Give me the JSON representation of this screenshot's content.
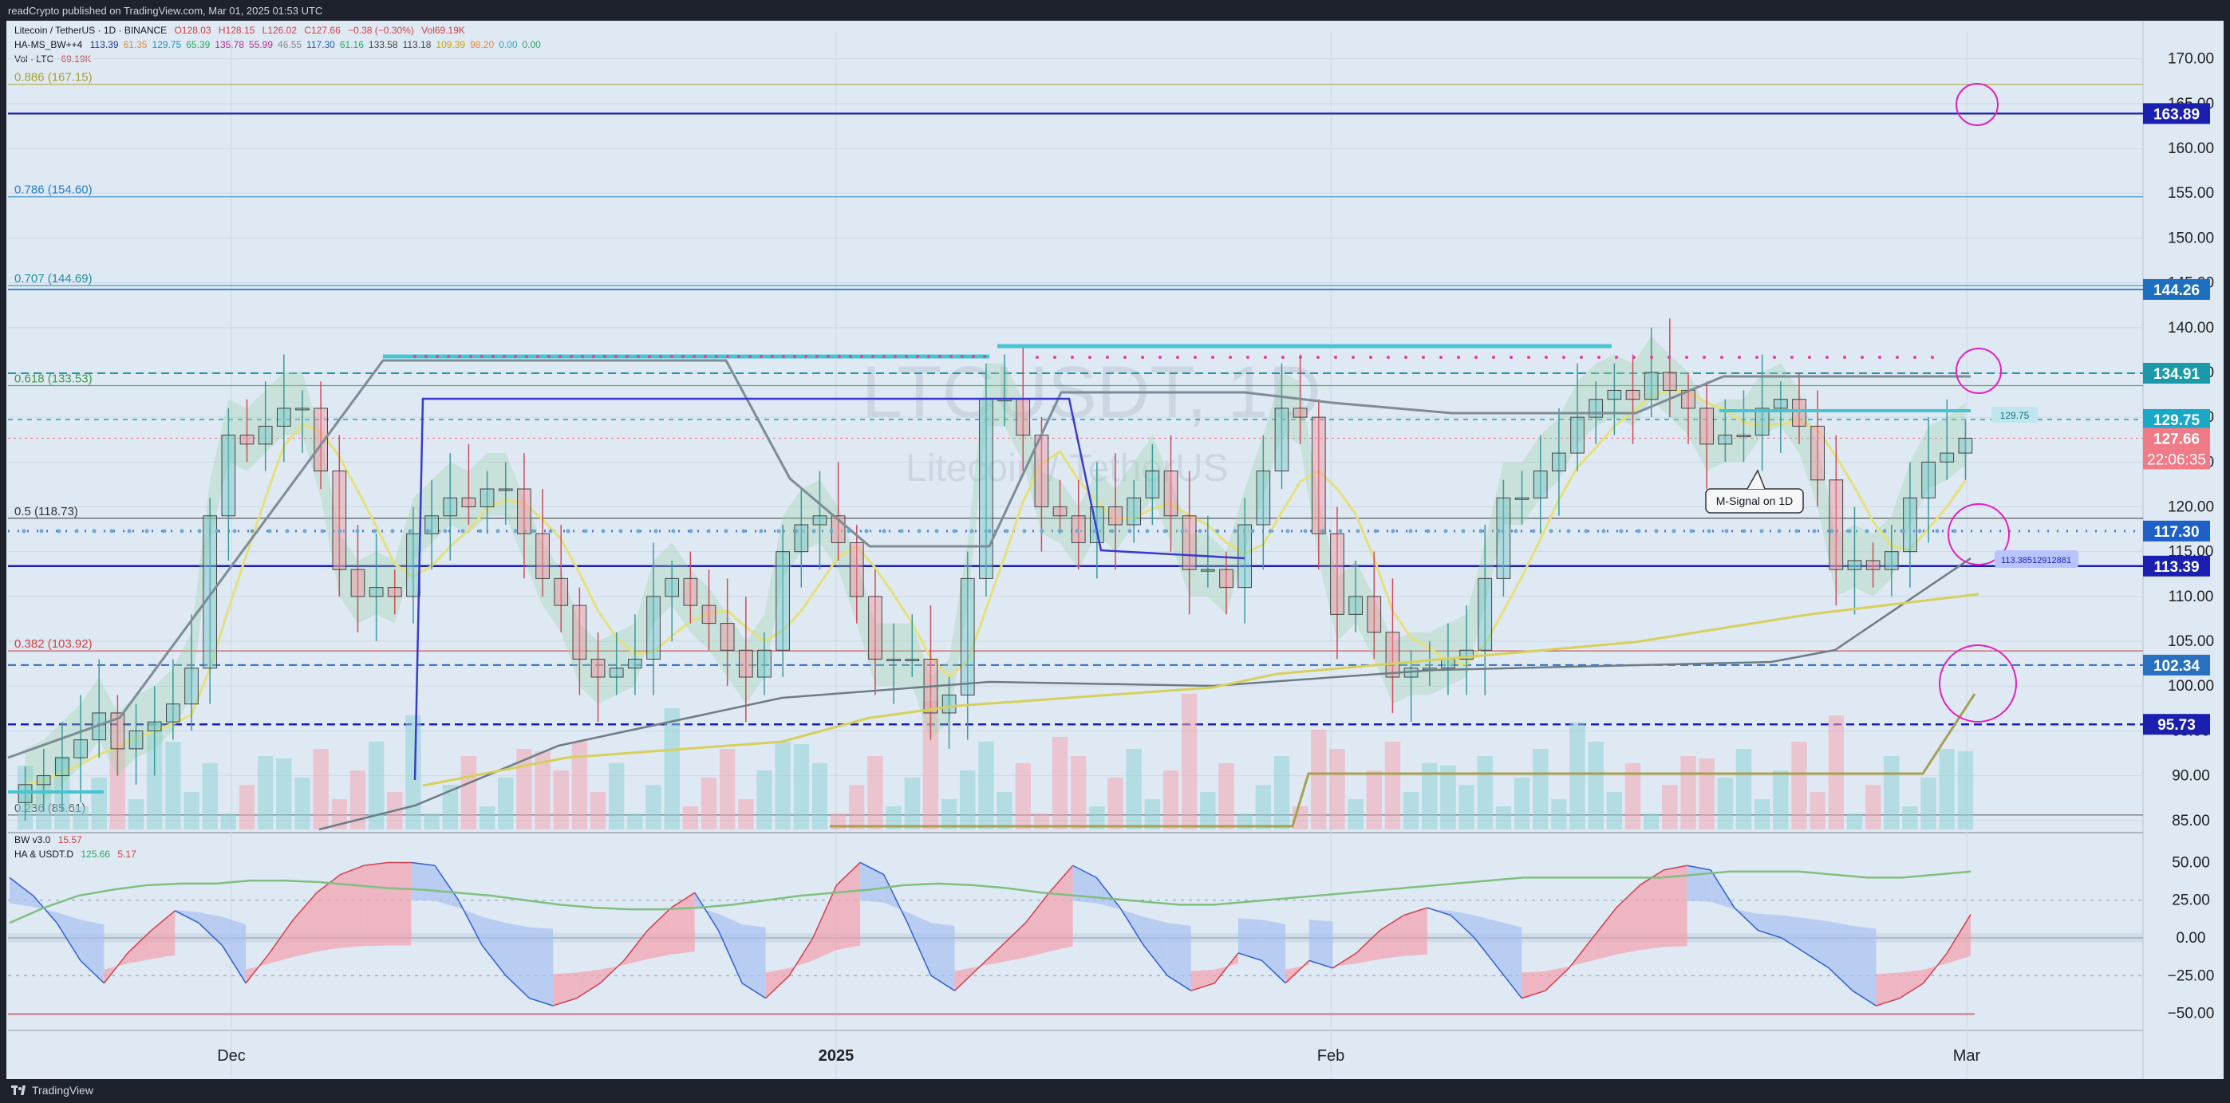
{
  "header": {
    "published_by": "readCrypto published on TradingView.com, Mar 01, 2025 01:53 UTC"
  },
  "footer": {
    "brand": "TradingView"
  },
  "legend": {
    "symbol_line": "Litecoin / TetherUS · 1D · BINANCE",
    "ohlc": {
      "o": "O128.03",
      "h": "H128.15",
      "l": "L126.02",
      "c": "C127.66",
      "chg": "−0.38 (−0.30%)",
      "vol": "Vol69.19K"
    },
    "ind1_name": "HA-MS_BW++4",
    "ind1_values": [
      "113.39",
      "61.35",
      "129.75",
      "65.39",
      "135.78",
      "55.99",
      "46.55",
      "117.30",
      "61.16",
      "133.58",
      "113.18",
      "109.39",
      "98.20",
      "0.00",
      "0.00"
    ],
    "ind1_colors": [
      "#1e3a8a",
      "#e8863a",
      "#1e90c0",
      "#2aa860",
      "#b03090",
      "#b03090",
      "#888888",
      "#1e60c0",
      "#2aa860",
      "#444444",
      "#444444",
      "#c9a400",
      "#e8863a",
      "#2aa8c0",
      "#2aa860"
    ],
    "vol_line": "Vol · LTC",
    "vol_value": "69.19K",
    "osc_name": "BW v3.0",
    "osc_value": "15.57",
    "ha_name": "HA & USDT.D",
    "ha_values": [
      "125.66",
      "5.17"
    ]
  },
  "watermark": {
    "symbol": "LTCUSDT, 1D",
    "name": "Litecoin / TetherUS"
  },
  "annotation": {
    "msignal": "M-Signal on 1D",
    "small_tag": "129.75",
    "band_tag": "113.38512912881"
  },
  "fib_labels": [
    {
      "text": "0.886 (167.15)",
      "price": 167.15,
      "color": "#a8a030"
    },
    {
      "text": "0.786 (154.60)",
      "price": 154.6,
      "color": "#2a7fbf"
    },
    {
      "text": "0.707 (144.69)",
      "price": 144.69,
      "color": "#1f8f9f"
    },
    {
      "text": "0.618 (133.53)",
      "price": 133.53,
      "color": "#3a9a4a"
    },
    {
      "text": "0.5 (118.73)",
      "price": 118.73,
      "color": "#333333"
    },
    {
      "text": "0.382 (103.92)",
      "price": 103.92,
      "color": "#d04040"
    },
    {
      "text": "0.236 (85.61)",
      "price": 85.61,
      "color": "#555555"
    }
  ],
  "price_tags": [
    {
      "text": "163.89",
      "price": 163.89,
      "bg": "#1a1fb0"
    },
    {
      "text": "144.26",
      "price": 144.26,
      "bg": "#1e6fbf"
    },
    {
      "text": "134.91",
      "price": 134.91,
      "bg": "#1a9aa8"
    },
    {
      "text": "129.75",
      "price": 129.75,
      "bg": "#1aa8c8"
    },
    {
      "text": "127.66",
      "price": 127.66,
      "bg": "#f07a86"
    },
    {
      "text": "117.30",
      "price": 117.3,
      "bg": "#1e5fc8"
    },
    {
      "text": "113.39",
      "price": 113.39,
      "bg": "#1a1fb0"
    },
    {
      "text": "102.34",
      "price": 102.34,
      "bg": "#2a70c0"
    },
    {
      "text": "95.73",
      "price": 95.73,
      "bg": "#1a1fb0"
    }
  ],
  "countdown": "22:06:35",
  "chart_data": [
    {
      "type": "candlestick",
      "title": "LTCUSDT, 1D",
      "y_axis_ticks": [
        170.0,
        165.0,
        160.0,
        155.0,
        150.0,
        145.0,
        140.0,
        135.0,
        130.0,
        125.0,
        120.0,
        115.0,
        110.0,
        105.0,
        100.0,
        95.0,
        90.0,
        85.0
      ],
      "ylim": [
        84,
        173
      ],
      "x_ticks": [
        "Dec",
        "2025",
        "Feb",
        "Mar"
      ],
      "series": [
        {
          "name": "LTCUSDT",
          "ohlc_close_path": [
            89,
            90,
            92,
            94,
            97,
            93,
            95,
            96,
            98,
            102,
            119,
            128,
            127,
            129,
            131,
            131,
            124,
            113,
            110,
            111,
            110,
            117,
            119,
            121,
            120,
            122,
            122,
            117,
            112,
            109,
            103,
            101,
            102,
            103,
            110,
            112,
            109,
            107,
            104,
            101,
            104,
            115,
            118,
            119,
            116,
            110,
            103,
            103,
            103,
            97,
            99,
            112,
            132,
            132,
            128,
            120,
            119,
            116,
            120,
            118,
            121,
            124,
            119,
            113,
            113,
            111,
            118,
            124,
            131,
            130,
            117,
            108,
            110,
            106,
            101,
            102,
            102,
            103,
            104,
            112,
            121,
            121,
            124,
            126,
            130,
            132,
            133,
            132,
            135,
            133,
            131,
            127,
            128,
            128,
            131,
            132,
            129,
            123,
            113,
            114,
            113,
            115,
            121,
            125,
            126,
            127.66
          ]
        }
      ]
    },
    {
      "type": "line",
      "title": "BW v3.0",
      "y_axis_ticks": [
        50.0,
        25.0,
        0.0,
        -25.0,
        -50.0
      ],
      "ylim": [
        -55,
        55
      ],
      "series": [
        {
          "name": "BW v3.0",
          "values": [
            40,
            28,
            10,
            -15,
            -30,
            -10,
            5,
            18,
            10,
            -5,
            -30,
            -10,
            12,
            30,
            42,
            48,
            50,
            50,
            48,
            25,
            -5,
            -25,
            -40,
            -45,
            -40,
            -30,
            -15,
            5,
            20,
            30,
            5,
            -30,
            -40,
            -25,
            0,
            35,
            50,
            42,
            10,
            -25,
            -35,
            -20,
            -5,
            10,
            30,
            48,
            40,
            20,
            -5,
            -25,
            -35,
            -30,
            -10,
            -15,
            -30,
            -15,
            -20,
            -10,
            5,
            15,
            20,
            15,
            0,
            -20,
            -40,
            -35,
            -20,
            0,
            20,
            35,
            45,
            48,
            45,
            20,
            5,
            0,
            -10,
            -20,
            -35,
            -45,
            -40,
            -30,
            -10,
            15.57
          ]
        },
        {
          "name": "HA & USDT.D",
          "values": [
            10,
            20,
            28,
            32,
            35,
            36,
            36,
            38,
            38,
            37,
            35,
            33,
            32,
            30,
            28,
            25,
            22,
            20,
            19,
            19,
            20,
            22,
            25,
            28,
            30,
            32,
            35,
            36,
            35,
            33,
            30,
            28,
            26,
            24,
            22,
            22,
            24,
            26,
            28,
            30,
            32,
            34,
            36,
            38,
            40,
            40,
            40,
            40,
            40,
            42,
            44,
            44,
            44,
            42,
            40,
            40,
            42,
            44
          ]
        }
      ]
    }
  ]
}
